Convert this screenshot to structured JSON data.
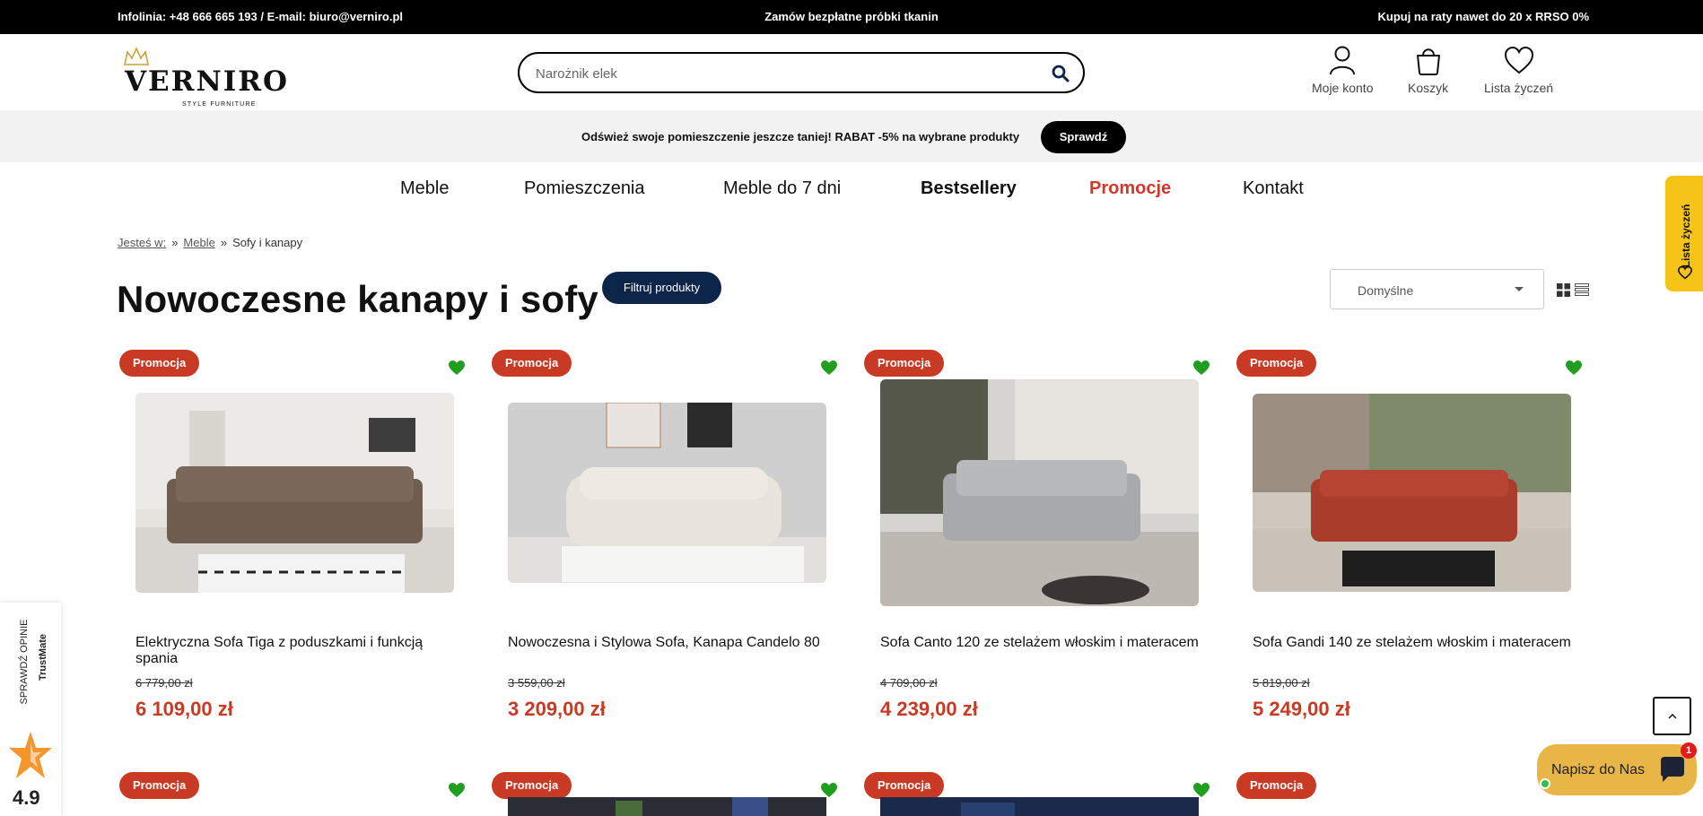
{
  "topbar": {
    "contact_label": "Infolinia:",
    "phone": "+48 666 665 193",
    "email_label": "/ E-mail:",
    "email": "biuro@verniro.pl",
    "center": "Zamów bezpłatne próbki tkanin",
    "right_prefix": "Kupuj na raty nawet do",
    "right_bold": "20 x RRSO 0%"
  },
  "logo": {
    "name": "VERNIRO",
    "tagline": "STYLE FURNITURE"
  },
  "search": {
    "placeholder": "Narożnik elek",
    "icon": "search-icon"
  },
  "header_actions": [
    {
      "label": "Moje konto",
      "icon": "user-icon"
    },
    {
      "label": "Koszyk",
      "icon": "bag-icon"
    },
    {
      "label": "Lista życzeń",
      "icon": "heart-icon"
    }
  ],
  "promo": {
    "text": "Odśwież swoje pomieszczenie jeszcze taniej! RABAT -5% na wybrane produkty",
    "button": "Sprawdź"
  },
  "nav": [
    "Meble",
    "Pomieszczenia",
    "Meble do 7 dni",
    "Bestsellery",
    "Promocje",
    "Kontakt"
  ],
  "breadcrumb": {
    "prefix": "Jesteś w:",
    "items": [
      "Meble",
      "Sofy i kanapy"
    ]
  },
  "page": {
    "title": "Nowoczesne kanapy i sofy",
    "filter_button": "Filtruj produkty",
    "sort_value": "Domyślne"
  },
  "products": [
    {
      "badge": "Promocja",
      "name": "Elektryczna Sofa Tiga z poduszkami i funkcją spania",
      "old_price": "6 779,00 zł",
      "price": "6 109,00 zł"
    },
    {
      "badge": "Promocja",
      "name": "Nowoczesna i Stylowa Sofa, Kanapa Candelo 80",
      "old_price": "3 559,00 zł",
      "price": "3 209,00 zł"
    },
    {
      "badge": "Promocja",
      "name": "Sofa Canto 120 ze stelażem włoskim i materacem",
      "old_price": "4 709,00 zł",
      "price": "4 239,00 zł"
    },
    {
      "badge": "Promocja",
      "name": "Sofa Gandi 140 ze stelażem włoskim i materacem",
      "old_price": "5 819,00 zł",
      "price": "5 249,00 zł"
    }
  ],
  "products_row2": [
    {
      "badge": "Promocja"
    },
    {
      "badge": "Promocja"
    },
    {
      "badge": "Promocja"
    },
    {
      "badge": "Promocja"
    }
  ],
  "side": {
    "wishlist_tab": "Lista życzeń",
    "trust_label": "SPRAWDŹ OPINIE",
    "trust_brand": "TrustMate",
    "trust_score": "4.9",
    "chat_label": "Napisz do Nas",
    "chat_notifications": "1"
  },
  "colors": {
    "accent_red": "#c83a24",
    "promo_red": "#d2372b",
    "navy": "#0c2548",
    "heart_green": "#1f9e1f",
    "chat_yellow": "#e8b547",
    "wish_yellow": "#f5c416"
  }
}
